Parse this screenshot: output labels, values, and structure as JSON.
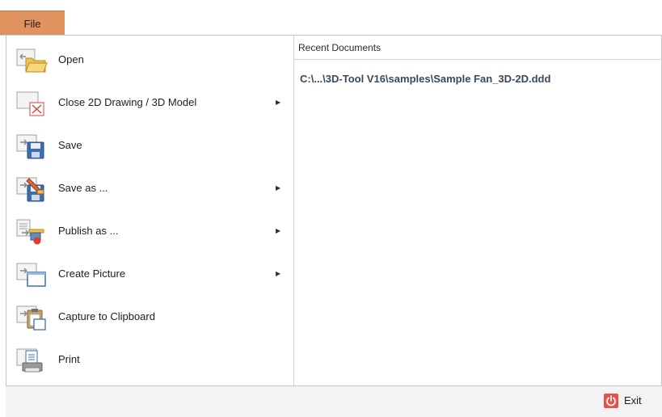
{
  "tab": {
    "file": "File"
  },
  "menu": {
    "items": [
      {
        "label": "Open",
        "icon": "open-folder-icon",
        "has_submenu": false
      },
      {
        "label": "Close 2D Drawing / 3D Model",
        "icon": "close-model-icon",
        "has_submenu": true
      },
      {
        "label": "Save",
        "icon": "save-disk-icon",
        "has_submenu": false
      },
      {
        "label": "Save as ...",
        "icon": "save-as-icon",
        "has_submenu": true
      },
      {
        "label": "Publish as ...",
        "icon": "publish-icon",
        "has_submenu": true
      },
      {
        "label": "Create Picture",
        "icon": "create-picture-icon",
        "has_submenu": true
      },
      {
        "label": "Capture to Clipboard",
        "icon": "clipboard-icon",
        "has_submenu": false
      },
      {
        "label": "Print",
        "icon": "printer-icon",
        "has_submenu": false
      }
    ],
    "submenu_arrow": "▶"
  },
  "recent": {
    "header": "Recent Documents",
    "documents": [
      "C:\\...\\3D-Tool V16\\samples\\Sample Fan_3D-2D.ddd"
    ]
  },
  "footer": {
    "exit_label": "Exit",
    "exit_icon": "power-icon"
  },
  "colors": {
    "file_tab": "#e1935f",
    "exit_icon": "#e8504a",
    "recent_doc_text": "#3a4a5a"
  }
}
